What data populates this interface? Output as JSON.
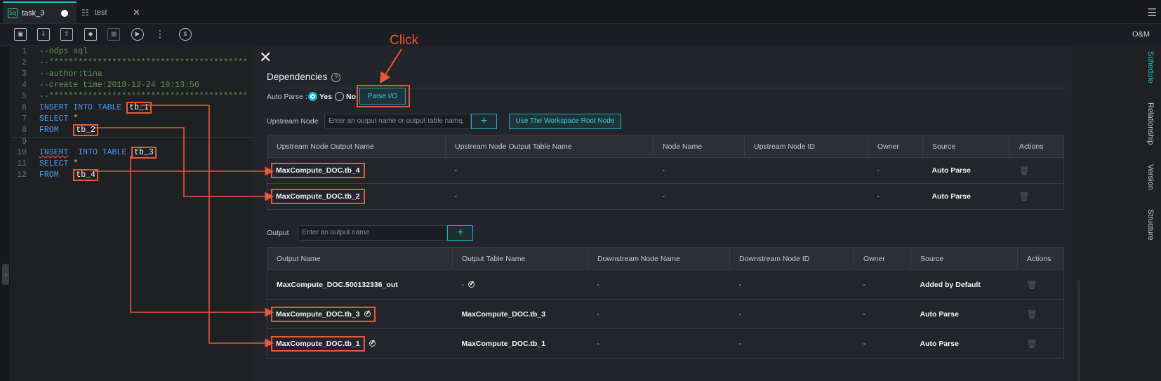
{
  "tabs": [
    {
      "label": "task_3",
      "icon": "sql-file-icon",
      "modified": true
    },
    {
      "label": "test",
      "icon": "workflow-icon"
    }
  ],
  "toolbar": {
    "right_label": "O&M"
  },
  "editor": {
    "lines": [
      {
        "n": "1",
        "text": "--odps sql"
      },
      {
        "n": "2",
        "text": "--*****************************************"
      },
      {
        "n": "3",
        "text": "--author:tina"
      },
      {
        "n": "4",
        "text": "--create time:2018-12-24 10:13:56"
      },
      {
        "n": "5",
        "text": "--*****************************************"
      },
      {
        "n": "6",
        "kw": "INSERT INTO TABLE",
        "table": "tb_1"
      },
      {
        "n": "7",
        "kw": "SELECT",
        "plain": "*"
      },
      {
        "n": "8",
        "kw": "FROM",
        "table": "tb_2"
      },
      {
        "n": "9",
        "text": ""
      },
      {
        "n": "10",
        "kw_a": "INSERT",
        "kw_b": "INTO TABLE",
        "table": "tb_3"
      },
      {
        "n": "11",
        "kw": "SELECT",
        "plain": "*"
      },
      {
        "n": "12",
        "kw": "FROM",
        "table": "tb_4"
      }
    ]
  },
  "annotation": {
    "label": "Click",
    "color": "#f0562e"
  },
  "dependencies": {
    "title": "Dependencies",
    "auto_parse_label": "Auto Parse :",
    "yes_label": "Yes",
    "no_label": "No",
    "auto_parse_selected": "Yes",
    "parse_button": "Parse I/O",
    "upstream_label": "Upstream Node",
    "upstream_placeholder": "Enter an output name or output table name",
    "root_button": "Use The Workspace Root Node",
    "upstream_table": {
      "headers": [
        "Upstream Node Output Name",
        "Upstream Node Output Table Name",
        "Node Name",
        "Upstream Node ID",
        "Owner",
        "Source",
        "Actions"
      ],
      "rows": [
        [
          "MaxCompute_DOC.tb_4",
          "-",
          "-",
          "",
          "-",
          "Auto Parse"
        ],
        [
          "MaxCompute_DOC.tb_2",
          "-",
          "-",
          "",
          "-",
          "Auto Parse"
        ]
      ]
    },
    "output_label": "Output",
    "output_placeholder": "Enter an output name",
    "output_table": {
      "headers": [
        "Output Name",
        "Output Table Name",
        "Downstream Node Name",
        "Downstream Node ID",
        "Owner",
        "Source",
        "Actions"
      ],
      "rows": [
        [
          "MaxCompute_DOC.500132336_out",
          "-",
          "-",
          "-",
          "-",
          "Added by Default"
        ],
        [
          "MaxCompute_DOC.tb_3",
          "MaxCompute_DOC.tb_3",
          "-",
          "-",
          "-",
          "Auto Parse"
        ],
        [
          "MaxCompute_DOC.tb_1",
          "MaxCompute_DOC.tb_1",
          "-",
          "-",
          "-",
          "Auto Parse"
        ]
      ]
    }
  },
  "right_rail": [
    "Schedule",
    "Relationship",
    "Version",
    "Structure"
  ],
  "colors": {
    "accent": "#19c3c3",
    "highlight": "#e8593a"
  }
}
